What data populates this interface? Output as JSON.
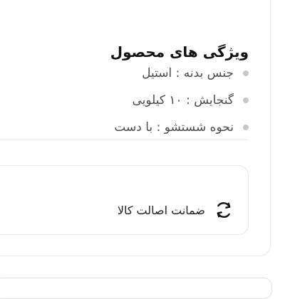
{
  "features": {
    "title": "ویژگی های محصول",
    "items": [
      {
        "text": "جنس بدنه : استیل"
      },
      {
        "text": "گنجایش : ۱۰ کیلویی"
      },
      {
        "text": "نحوه شستشو : با دست"
      }
    ]
  },
  "guarantee": {
    "label": "ضمانت اصالت کالا",
    "icon": "refresh-icon"
  }
}
